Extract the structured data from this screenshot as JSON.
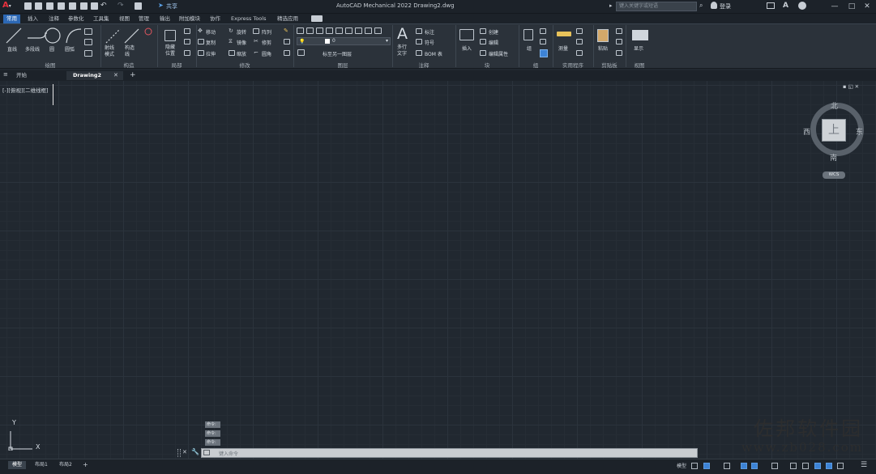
{
  "title_bar": {
    "app_logo": "A",
    "app_logo_dropdown": "▾",
    "share_label": "共享",
    "title": "AutoCAD Mechanical 2022    Drawing2.dwg",
    "search_placeholder": "键入关键字或短语",
    "login_label": "登录",
    "window_controls": {
      "minimize": "—",
      "maximize": "□",
      "close": "✕"
    }
  },
  "menu_tabs": [
    "常用",
    "插入",
    "注释",
    "参数化",
    "工具集",
    "视图",
    "管理",
    "输出",
    "附加模块",
    "协作",
    "Express Tools",
    "精选应用"
  ],
  "ribbon": {
    "draw": {
      "title": "绘图",
      "line": "直线",
      "polyline": "多段线",
      "circle": "圆",
      "arc": "圆弧"
    },
    "construct": {
      "title": "构造",
      "ray_mode": "射线\n模式",
      "construct_line": "构造\n线"
    },
    "detail": {
      "title": "局部",
      "hide_label": "隐藏\n位置"
    },
    "modify": {
      "title": "修改",
      "move": "移动",
      "rotate": "旋转",
      "array": "阵列",
      "copy": "复制",
      "mirror": "镜像",
      "fillet": "修剪",
      "stretch": "拉伸",
      "scale": "缩放",
      "chamfer": "圆角"
    },
    "layers": {
      "title": "图层",
      "layer_value": "0",
      "match_layer": "标至另一图层"
    },
    "annotation": {
      "title": "注释",
      "multiline_text": "多行\n文字",
      "dimension": "标注",
      "symbol": "符号",
      "bom": "BOM 表"
    },
    "block": {
      "title": "块",
      "insert": "插入",
      "create": "创建",
      "edit": "编辑",
      "edit_attributes": "编辑属性"
    },
    "groups": {
      "title": "组",
      "group": "组"
    },
    "utilities": {
      "title": "实用程序",
      "measure": "测量"
    },
    "clipboard": {
      "title": "剪贴板",
      "paste": "粘贴"
    },
    "view": {
      "title": "视图",
      "display": "显示"
    }
  },
  "doc_tabs": {
    "start": "开始",
    "drawing": "Drawing2",
    "close": "✕",
    "add": "+"
  },
  "viewport": {
    "label": "[-][俯视][二维线框]",
    "controls": "▪ ◱ ✕"
  },
  "viewcube": {
    "north": "北",
    "south": "南",
    "east": "东",
    "west": "西",
    "face": "上",
    "wcs": "WCS"
  },
  "ucs": {
    "x": "X",
    "y": "Y"
  },
  "command": {
    "history": [
      "命令:",
      "命令:",
      "命令:"
    ],
    "placeholder": "键入命令",
    "close": "✕"
  },
  "layout_tabs": [
    "模型",
    "布局1",
    "布局2"
  ],
  "layout_add": "+",
  "status": {
    "model_label": "模型"
  },
  "watermark": {
    "title": "佐邦软件园",
    "url": "www.zb028.com"
  }
}
